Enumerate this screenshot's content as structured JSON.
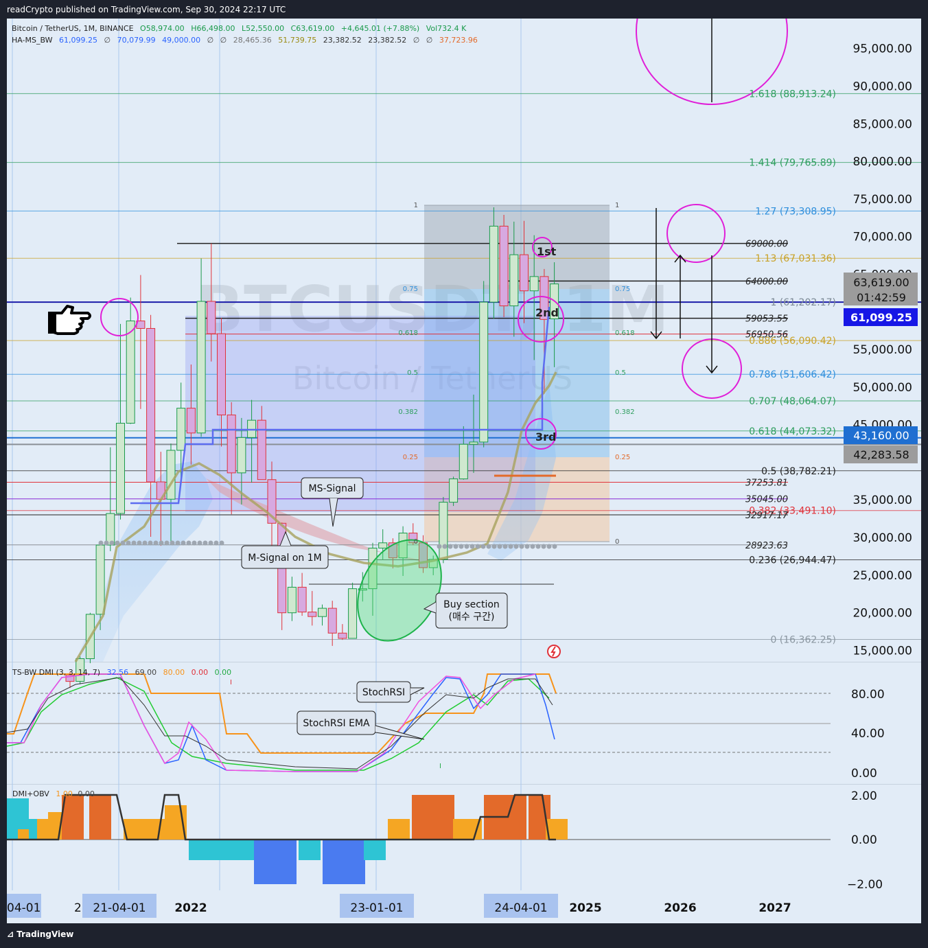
{
  "header": {
    "published": "readCrypto published on TradingView.com, Sep 30, 2024 22:17 UTC"
  },
  "footer": {
    "brand": "TradingView"
  },
  "symbol_line": {
    "name": "Bitcoin / TetherUS, 1M, BINANCE",
    "o": "O58,974.00",
    "h": "H66,498.00",
    "l": "L52,550.00",
    "c": "C63,619.00",
    "chg": "+4,645.01 (+7.88%)",
    "vol": "Vol732.4 K"
  },
  "indicator_line": {
    "name": "HA-MS_BW",
    "values": [
      "61,099.25",
      "∅",
      "70,079.99",
      "49,000.00",
      "∅",
      "∅",
      "28,465.36",
      "51,739.75",
      "23,382.52",
      "23,382.52",
      "∅",
      "∅",
      "37,723.96"
    ]
  },
  "watermark": {
    "line1": "BTCUSDT, 1M",
    "line2": "Bitcoin / TetherUS"
  },
  "price_axis": {
    "ticks": [
      "95,000.00",
      "90,000.00",
      "85,000.00",
      "80,000.00",
      "75,000.00",
      "70,000.00",
      "65,000.00",
      "55,000.00",
      "50,000.00",
      "45,000.00",
      "35,000.00",
      "30,000.00",
      "25,000.00",
      "20,000.00",
      "15,000.00"
    ]
  },
  "price_badges": {
    "last": "63,619.00",
    "countdown": "01:42:59",
    "ha": "61,099.25",
    "level1": "43,160.00",
    "level2": "42,283.58"
  },
  "fib_ext": [
    {
      "label": "1.618 (88,913.24)",
      "price": 88913.24,
      "color": "#2e9e5e"
    },
    {
      "label": "1.414 (79,765.89)",
      "price": 79765.89,
      "color": "#2e9e5e"
    },
    {
      "label": "1.27 (73,308.95)",
      "price": 73308.95,
      "color": "#2f8fdc"
    },
    {
      "label": "1.13 (67,031.36)",
      "price": 67031.36,
      "color": "#c9a227"
    },
    {
      "label": "1 (61,202.17)",
      "price": 61202.17,
      "color": "#7a8894"
    },
    {
      "label": "0.886 (56,090.42)",
      "price": 56090.42,
      "color": "#c9a227"
    },
    {
      "label": "0.786 (51,606.42)",
      "price": 51606.42,
      "color": "#2f8fdc"
    },
    {
      "label": "0.707 (48,064.07)",
      "price": 48064.07,
      "color": "#2e9e5e"
    },
    {
      "label": "0.618 (44,073.32)",
      "price": 44073.32,
      "color": "#2e9e5e"
    },
    {
      "label": "0.5 (38,782.21)",
      "price": 38782.21,
      "color": "#222222"
    },
    {
      "label": "0.382 (33,491.10)",
      "price": 33491.1,
      "color": "#e0323a"
    },
    {
      "label": "0.236 (26,944.47)",
      "price": 26944.47,
      "color": "#222222"
    },
    {
      "label": "0 (16,362.25)",
      "price": 16362.25,
      "color": "#8a96a0"
    }
  ],
  "levels": [
    {
      "label": "69000.00",
      "price": 69000
    },
    {
      "label": "64000.00",
      "price": 64000
    },
    {
      "label": "59053.55",
      "price": 59053.55
    },
    {
      "label": "56950.56",
      "price": 56950.56
    },
    {
      "label": "37253.81",
      "price": 37253.81
    },
    {
      "label": "35045.00",
      "price": 35045
    },
    {
      "label": "32917.17",
      "price": 32917.17
    },
    {
      "label": "28923.63",
      "price": 28923.63
    }
  ],
  "fib_box": {
    "labels": [
      "1",
      "0.75",
      "0.618",
      "0.5",
      "0.382",
      "0.25",
      "0"
    ]
  },
  "annotations": {
    "ms_signal": "MS-Signal",
    "m_signal": "M-Signal on 1M",
    "buy_section_1": "Buy section",
    "buy_section_2": "(매수 구간)",
    "first": "1st",
    "second": "2nd",
    "third": "3rd",
    "stochrsi": "StochRSI",
    "stochrsi_ema": "StochRSI EMA"
  },
  "stoch_panel": {
    "title": "TS-BW DMI (3, 3, 14, 7)",
    "values": [
      {
        "v": "32.56",
        "c": "#2962ff"
      },
      {
        "v": "69.00",
        "c": "#444444"
      },
      {
        "v": "80.00",
        "c": "#f7931a"
      },
      {
        "v": "0.00",
        "c": "#e0323a"
      },
      {
        "v": "0.00",
        "c": "#22aa44"
      }
    ],
    "ticks": [
      "80.00",
      "40.00",
      "0.00"
    ]
  },
  "dmi_panel": {
    "title": "DMI+OBV",
    "values": [
      {
        "v": "1.00",
        "c": "#f7931a"
      },
      {
        "v": "0.00",
        "c": "#444444"
      }
    ],
    "ticks": [
      "2.00",
      "0.00",
      "−2.00"
    ]
  },
  "time_axis": {
    "labels": [
      "04-01",
      "2",
      "21-04-01",
      "2022",
      "23-01-01",
      "24-04-01",
      "2025",
      "2026",
      "2027"
    ]
  },
  "chart_data": {
    "type": "candlestick",
    "interval": "1M",
    "symbol": "BTCUSDT",
    "y_range": [
      13000,
      98000
    ],
    "candles": [
      {
        "t": "2020-09",
        "o": 11650,
        "h": 12050,
        "l": 9900,
        "c": 10780
      },
      {
        "t": "2020-10",
        "o": 10780,
        "h": 14100,
        "l": 10400,
        "c": 13800
      },
      {
        "t": "2020-11",
        "o": 13800,
        "h": 19900,
        "l": 13200,
        "c": 19700
      },
      {
        "t": "2020-12",
        "o": 19700,
        "h": 29300,
        "l": 17600,
        "c": 28900
      },
      {
        "t": "2021-01",
        "o": 28900,
        "h": 41900,
        "l": 28100,
        "c": 33100
      },
      {
        "t": "2021-02",
        "o": 33100,
        "h": 58300,
        "l": 32300,
        "c": 45100
      },
      {
        "t": "2021-03",
        "o": 45100,
        "h": 61800,
        "l": 45000,
        "c": 58700
      },
      {
        "t": "2021-04",
        "o": 58700,
        "h": 64800,
        "l": 47000,
        "c": 57700
      },
      {
        "t": "2021-05",
        "o": 57700,
        "h": 59500,
        "l": 30000,
        "c": 37300
      },
      {
        "t": "2021-06",
        "o": 37300,
        "h": 41300,
        "l": 28800,
        "c": 35000
      },
      {
        "t": "2021-07",
        "o": 35000,
        "h": 42400,
        "l": 29300,
        "c": 41500
      },
      {
        "t": "2021-08",
        "o": 41500,
        "h": 50500,
        "l": 37300,
        "c": 47100
      },
      {
        "t": "2021-09",
        "o": 47100,
        "h": 52900,
        "l": 39600,
        "c": 43800
      },
      {
        "t": "2021-10",
        "o": 43800,
        "h": 67000,
        "l": 43300,
        "c": 61300
      },
      {
        "t": "2021-11",
        "o": 61300,
        "h": 69000,
        "l": 53300,
        "c": 57000
      },
      {
        "t": "2021-12",
        "o": 57000,
        "h": 59100,
        "l": 42000,
        "c": 46200
      },
      {
        "t": "2022-01",
        "o": 46200,
        "h": 47900,
        "l": 33000,
        "c": 38500
      },
      {
        "t": "2022-02",
        "o": 38500,
        "h": 45800,
        "l": 34300,
        "c": 43200
      },
      {
        "t": "2022-03",
        "o": 43200,
        "h": 48200,
        "l": 37200,
        "c": 45500
      },
      {
        "t": "2022-04",
        "o": 45500,
        "h": 47400,
        "l": 37600,
        "c": 37600
      },
      {
        "t": "2022-05",
        "o": 37600,
        "h": 40000,
        "l": 26700,
        "c": 31800
      },
      {
        "t": "2022-06",
        "o": 31800,
        "h": 31900,
        "l": 17600,
        "c": 19900
      },
      {
        "t": "2022-07",
        "o": 19900,
        "h": 24700,
        "l": 18800,
        "c": 23300
      },
      {
        "t": "2022-08",
        "o": 23300,
        "h": 25200,
        "l": 19500,
        "c": 20000
      },
      {
        "t": "2022-09",
        "o": 20000,
        "h": 22800,
        "l": 18200,
        "c": 19400
      },
      {
        "t": "2022-10",
        "o": 19400,
        "h": 21000,
        "l": 18200,
        "c": 20500
      },
      {
        "t": "2022-11",
        "o": 20500,
        "h": 21500,
        "l": 15500,
        "c": 17200
      },
      {
        "t": "2022-12",
        "o": 17200,
        "h": 18400,
        "l": 16300,
        "c": 16500
      },
      {
        "t": "2023-01",
        "o": 16500,
        "h": 23900,
        "l": 16500,
        "c": 23100
      },
      {
        "t": "2023-02",
        "o": 23100,
        "h": 25300,
        "l": 21400,
        "c": 23100
      },
      {
        "t": "2023-03",
        "o": 23100,
        "h": 29200,
        "l": 19500,
        "c": 28500
      },
      {
        "t": "2023-04",
        "o": 28500,
        "h": 31000,
        "l": 26900,
        "c": 29200
      },
      {
        "t": "2023-05",
        "o": 29200,
        "h": 29800,
        "l": 25800,
        "c": 27200
      },
      {
        "t": "2023-06",
        "o": 27200,
        "h": 31400,
        "l": 24800,
        "c": 30500
      },
      {
        "t": "2023-07",
        "o": 30500,
        "h": 31800,
        "l": 28900,
        "c": 29200
      },
      {
        "t": "2023-08",
        "o": 29200,
        "h": 30200,
        "l": 25200,
        "c": 25900
      },
      {
        "t": "2023-09",
        "o": 25900,
        "h": 27500,
        "l": 24900,
        "c": 27000
      },
      {
        "t": "2023-10",
        "o": 27000,
        "h": 35300,
        "l": 26500,
        "c": 34600
      },
      {
        "t": "2023-11",
        "o": 34600,
        "h": 38000,
        "l": 34100,
        "c": 37700
      },
      {
        "t": "2023-12",
        "o": 37700,
        "h": 44700,
        "l": 37600,
        "c": 42300
      },
      {
        "t": "2024-01",
        "o": 42300,
        "h": 48900,
        "l": 38500,
        "c": 42600
      },
      {
        "t": "2024-02",
        "o": 42600,
        "h": 64000,
        "l": 41900,
        "c": 61200
      },
      {
        "t": "2024-03",
        "o": 61200,
        "h": 73800,
        "l": 59000,
        "c": 71300
      },
      {
        "t": "2024-04",
        "o": 71300,
        "h": 72800,
        "l": 59200,
        "c": 60700
      },
      {
        "t": "2024-05",
        "o": 60700,
        "h": 71900,
        "l": 56600,
        "c": 67500
      },
      {
        "t": "2024-06",
        "o": 67500,
        "h": 72000,
        "l": 58400,
        "c": 62700
      },
      {
        "t": "2024-07",
        "o": 62700,
        "h": 70100,
        "l": 53500,
        "c": 64600
      },
      {
        "t": "2024-08",
        "o": 64600,
        "h": 65600,
        "l": 49000,
        "c": 58900
      },
      {
        "t": "2024-09",
        "o": 58974,
        "h": 66498,
        "l": 52550,
        "c": 63619
      }
    ],
    "series": [
      {
        "name": "HA-MS_BW",
        "values": [
          61099.25,
          70079.99,
          49000,
          28465.36,
          51739.75,
          23382.52,
          37723.96
        ]
      }
    ],
    "xlabel": "",
    "ylabel": "",
    "grid": true
  }
}
